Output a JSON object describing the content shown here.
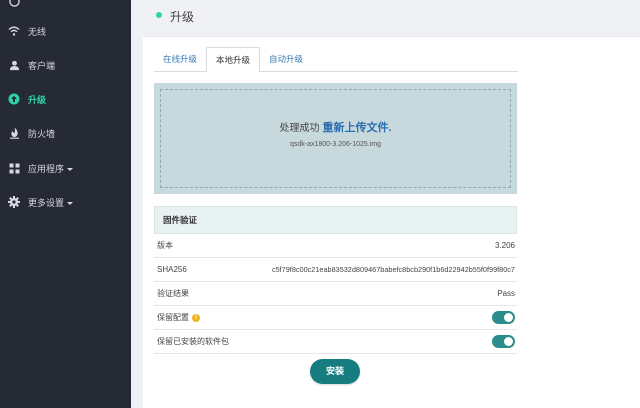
{
  "sidebar": {
    "items": [
      {
        "label": "",
        "icon": "home-icon"
      },
      {
        "label": "无线",
        "icon": "wifi-icon"
      },
      {
        "label": "客户端",
        "icon": "user-icon"
      },
      {
        "label": "升级",
        "icon": "upgrade-icon",
        "active": true
      },
      {
        "label": "防火墙",
        "icon": "flame-icon"
      },
      {
        "label": "应用程序",
        "icon": "apps-icon"
      },
      {
        "label": "更多设置",
        "icon": "gear-icon"
      }
    ]
  },
  "header": {
    "title": "升级"
  },
  "tabs": [
    {
      "label": "在线升级"
    },
    {
      "label": "本地升级",
      "active": true
    },
    {
      "label": "自动升级"
    }
  ],
  "upload": {
    "status": "处理成功",
    "reupload_label": "重新上传文件.",
    "filename": "qsdk-ax1800-3.206-1025.img"
  },
  "firmware": {
    "heading": "固件验证",
    "rows": [
      {
        "key": "版本",
        "value": "3.206"
      },
      {
        "key": "SHA256",
        "value": "c5f79f8c00c21eab83532d809467babefc8bcb290f1b6d22942b55f0f99f80c7"
      },
      {
        "key": "验证结果",
        "value": "Pass"
      }
    ],
    "keep_config_label": "保留配置",
    "keep_config_on": true,
    "keep_packages_label": "保留已安装的软件包",
    "keep_packages_on": true
  },
  "actions": {
    "install_label": "安装"
  },
  "colors": {
    "sidebar_bg": "#262a35",
    "accent": "#2ed3a6",
    "toggle_on": "#2b8c8c",
    "install_button": "#167c80",
    "link": "#2a6db0"
  }
}
